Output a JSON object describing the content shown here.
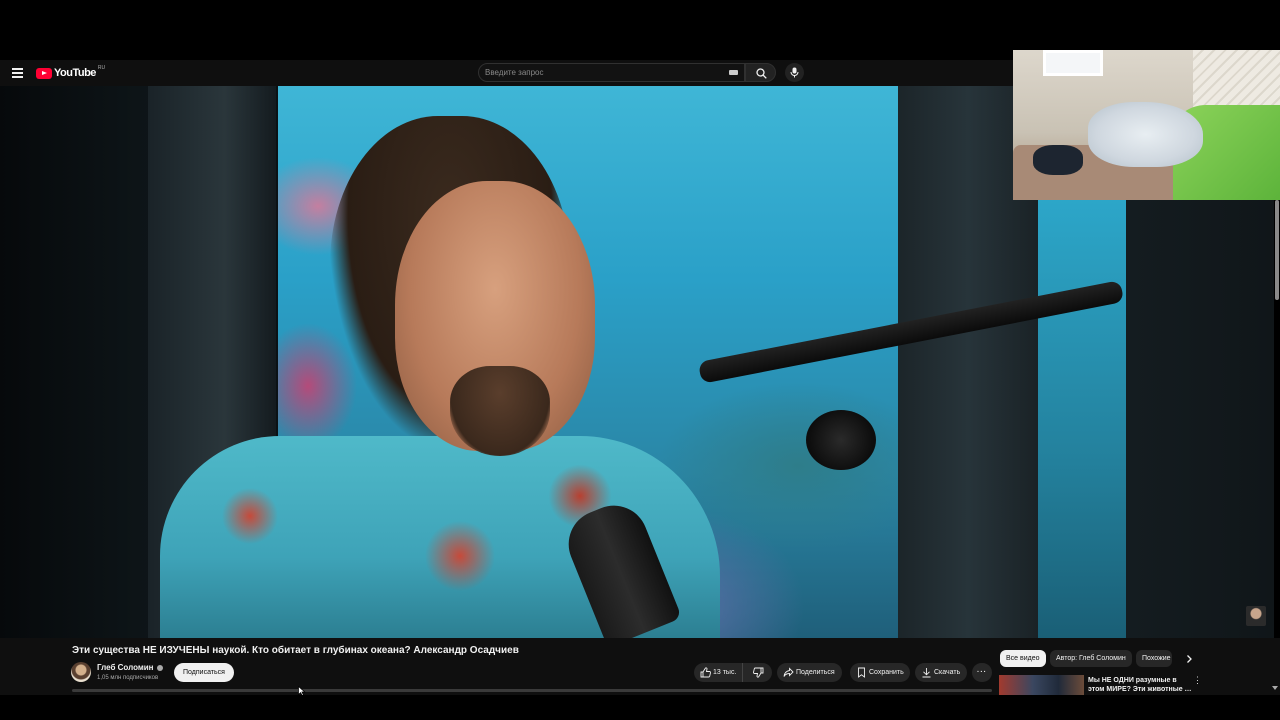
{
  "header": {
    "logo_text": "YouTube",
    "logo_region": "RU",
    "search_placeholder": "Введите запрос"
  },
  "video": {
    "title": "Эти существа НЕ ИЗУЧЕНЫ наукой. Кто обитает в глубинах океана? Александр Осадчиев"
  },
  "channel": {
    "name": "Глеб Соломин",
    "subscribers": "1,05 млн подписчиков",
    "subscribe_label": "Подписаться"
  },
  "actions": {
    "likes": "13 тыс.",
    "share": "Поделиться",
    "save": "Сохранить",
    "download": "Скачать",
    "more": "···"
  },
  "chips": [
    "Все видео",
    "Автор: Глеб Соломин",
    "Похожие"
  ],
  "recommendation": {
    "title": "Мы НЕ ОДНИ разумные в этом МИРЕ? Эти животные …",
    "menu": "⋮"
  },
  "colors": {
    "brand_red": "#ff0033",
    "background": "#0f0f0f",
    "chip_active": "#f1f1f1"
  }
}
